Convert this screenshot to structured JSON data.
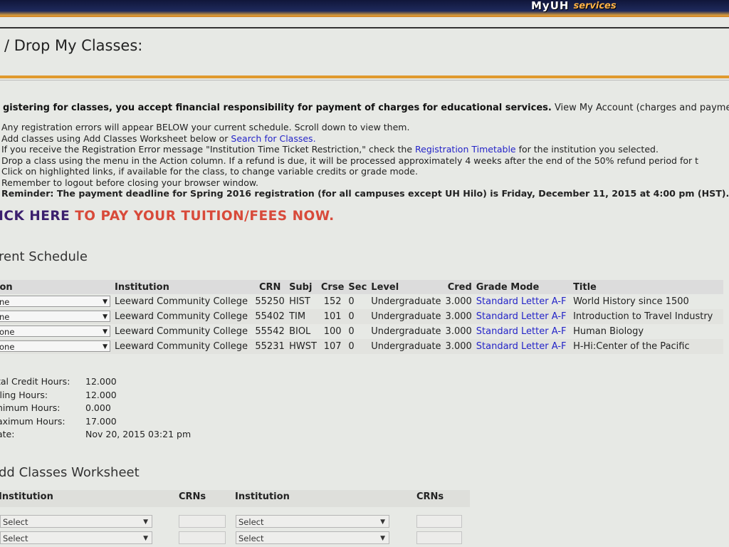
{
  "header": {
    "logo_primary": "MyUH",
    "logo_secondary": "services",
    "page_title": "/ Drop My Classes:"
  },
  "notice": {
    "agreement": "gistering for classes, you accept financial responsibility for payment of charges for educational services.",
    "account_link": "View My Account (charges and payments) fo",
    "line1": "Any registration errors will appear BELOW your current schedule. Scroll down to view them.",
    "line2_prefix": "Add classes using Add Classes Worksheet below or ",
    "line2_link": "Search for Classes.",
    "line3_prefix": "If you receive the Registration Error message \"Institution Time Ticket Restriction,\" check the ",
    "line3_link": "Registration Timetable",
    "line3_suffix": " for the institution you selected.",
    "line4": "Drop a class using the menu in the Action column. If a refund is due, it will be processed approximately 4 weeks after the end of the 50% refund period for t",
    "line5": "Click on highlighted links, if available for the class, to change variable credits or grade mode.",
    "line6": "Remember to logout before closing your browser window.",
    "reminder": "Reminder: The payment deadline for Spring 2016 registration (for all campuses except UH Hilo) is Friday, December 11, 2015 at 4:00 pm (HST)."
  },
  "pay": {
    "click_here": "ICK HERE",
    "rest": " TO PAY YOUR TUITION/FEES NOW."
  },
  "schedule": {
    "title": "rent Schedule",
    "headers": {
      "action": "ion",
      "institution": "Institution",
      "crn": "CRN",
      "subj": "Subj",
      "crse": "Crse",
      "sec": "Sec",
      "level": "Level",
      "cred": "Cred",
      "grade_mode": "Grade Mode",
      "title": "Title"
    },
    "rows": [
      {
        "action": "ne",
        "institution": "Leeward Community College",
        "crn": "55250",
        "subj": "HIST",
        "crse": "152",
        "sec": "0",
        "level": "Undergraduate",
        "cred": "3.000",
        "grade_mode": "Standard Letter A-F",
        "title": "World History since 1500"
      },
      {
        "action": "ne",
        "institution": "Leeward Community College",
        "crn": "55402",
        "subj": "TIM",
        "crse": "101",
        "sec": "0",
        "level": "Undergraduate",
        "cred": "3.000",
        "grade_mode": "Standard Letter A-F",
        "title": "Introduction to Travel Industry"
      },
      {
        "action": "one",
        "institution": "Leeward Community College",
        "crn": "55542",
        "subj": "BIOL",
        "crse": "100",
        "sec": "0",
        "level": "Undergraduate",
        "cred": "3.000",
        "grade_mode": "Standard Letter A-F",
        "title": "Human Biology"
      },
      {
        "action": "one",
        "institution": "Leeward Community College",
        "crn": "55231",
        "subj": "HWST",
        "crse": "107",
        "sec": "0",
        "level": "Undergraduate",
        "cred": "3.000",
        "grade_mode": "Standard Letter A-F",
        "title": "H-Hi:Center of the Pacific"
      }
    ]
  },
  "totals": [
    {
      "label": "tal Credit Hours:",
      "value": "12.000"
    },
    {
      "label": "iling Hours:",
      "value": "12.000"
    },
    {
      "label": "nimum Hours:",
      "value": "0.000"
    },
    {
      "label": "aximum Hours:",
      "value": "17.000"
    },
    {
      "label": "ate:",
      "value": "Nov 20, 2015 03:21 pm"
    }
  ],
  "worksheet": {
    "title": "dd Classes Worksheet",
    "col_institution_1": "Institution",
    "col_crns_1": "CRNs",
    "col_institution_2": "Institution",
    "col_crns_2": "CRNs",
    "select_placeholder": "Select"
  }
}
